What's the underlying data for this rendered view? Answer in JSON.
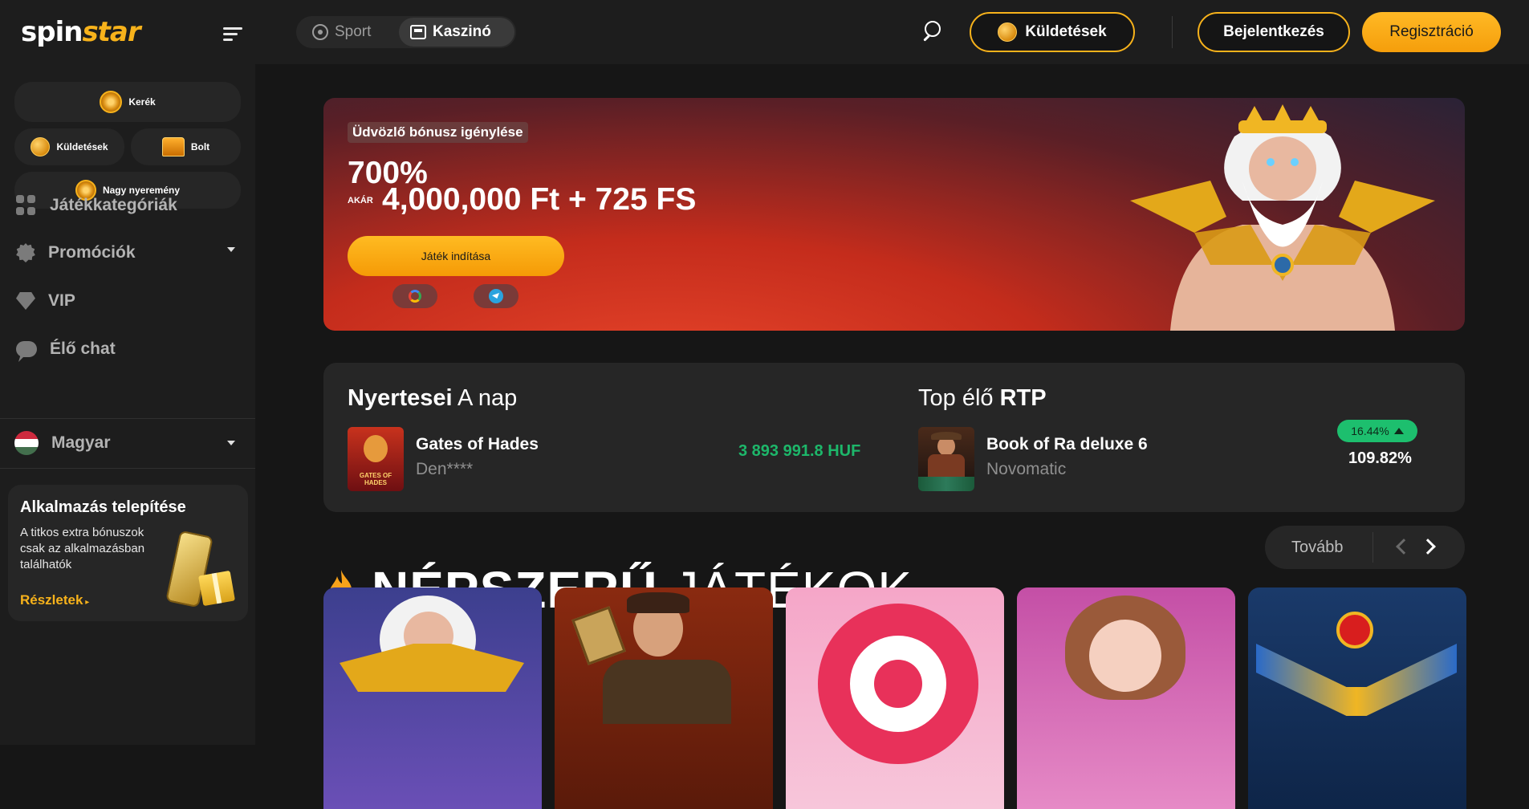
{
  "topbar": {
    "logo_white": "spin",
    "logo_yellow": "star",
    "sport_label": "Sport",
    "casino_label": "Kaszinó",
    "missions_label": "Küldetések",
    "login_label": "Bejelentkezés",
    "register_label": "Regisztráció"
  },
  "sidebar": {
    "quick": {
      "wheel": "Kerék",
      "missions": "Küldetések",
      "shop": "Bolt",
      "jackpot": "Nagy nyeremény"
    },
    "nav": {
      "categories": "Játékkategóriák",
      "promotions": "Promóciók",
      "vip": "VIP",
      "live_chat": "Élő chat"
    },
    "language": "Magyar",
    "app_card": {
      "title": "Alkalmazás telepítése",
      "description": "A titkos extra bónuszok csak az alkalmazásban találhatók",
      "link": "Részletek"
    }
  },
  "banner": {
    "tag": "Üdvözlő bónusz igénylése",
    "percent": "700%",
    "upto": "AKÁR",
    "amount": "4,000,000 Ft + 725 FS",
    "cta": "Játék indítása"
  },
  "winners": {
    "left_title_bold": "Nyertesei",
    "left_title_rest": " A nap",
    "game": "Gates of Hades",
    "player": "Den****",
    "win_amount": "3 893 991.8 HUF",
    "thumb_text": "GATES OF HADES",
    "right_title_rest": "Top élő ",
    "right_title_bold": "RTP",
    "rtp_game": "Book of Ra deluxe 6",
    "rtp_provider": "Novomatic",
    "rtp_change": "16.44%",
    "rtp_value": "109.82%"
  },
  "popular": {
    "title_bold": "NÉPSZERŰ",
    "title_rest": " JÁTÉKOK",
    "more_label": "Tovább"
  },
  "colors": {
    "accent": "#f7b21b",
    "win_green": "#1db76a",
    "badge_green": "#1dbf6e",
    "panel": "#262626",
    "background": "#161616"
  }
}
